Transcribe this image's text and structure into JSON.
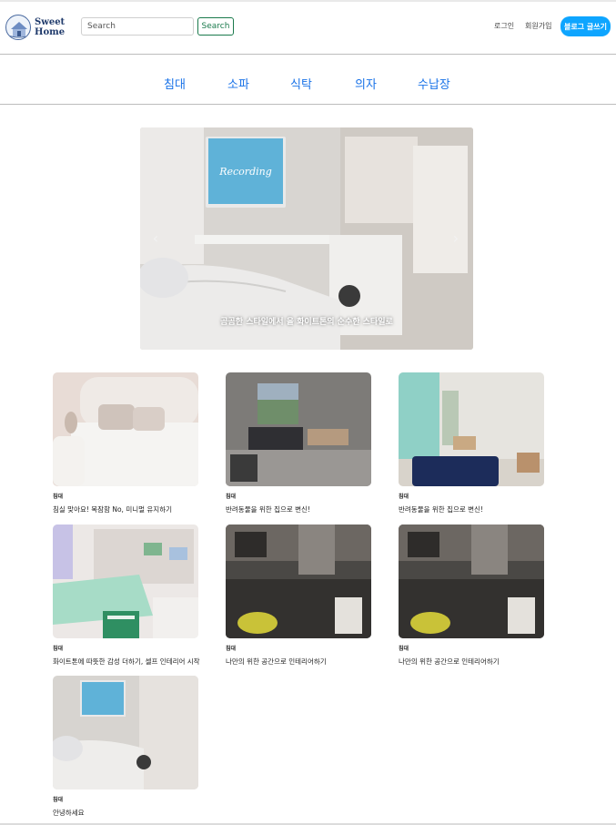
{
  "header": {
    "logo_text_line1": "Sweet",
    "logo_text_line2": "Home",
    "search_placeholder": "Search",
    "search_button": "Search",
    "login": "로그인",
    "signup": "회원가입",
    "write_button": "블로그 글쓰기"
  },
  "categories": [
    "침대",
    "소파",
    "식탁",
    "의자",
    "수납장"
  ],
  "carousel": {
    "caption": "곰곰한 스타일에서 을 화이트톤의 순수한 스타일로",
    "prev_icon": "chevron-left-icon",
    "next_icon": "chevron-right-icon",
    "monitor_text": "Recording"
  },
  "posts": [
    {
      "category": "침대",
      "title": "침실 맞아요! 목잠함 No, 미니멀 유지하기"
    },
    {
      "category": "침대",
      "title": "반려동물을 위한 집으로 변신!"
    },
    {
      "category": "침대",
      "title": "반려동물을 위한 집으로 변신!"
    },
    {
      "category": "침대",
      "title": "화이트톤에 따뜻한 감성 더하기, 셀프 인테리어 시작"
    },
    {
      "category": "침대",
      "title": "나만의 위한 공간으로 인테리어하기"
    },
    {
      "category": "침대",
      "title": "나만의 위한 공간으로 인테리어하기"
    },
    {
      "category": "침대",
      "title": "안녕하세요"
    }
  ],
  "colors": {
    "accent": "#0ea5ff",
    "category_link": "#1a73e8",
    "search_button": "#1a7a4c"
  }
}
